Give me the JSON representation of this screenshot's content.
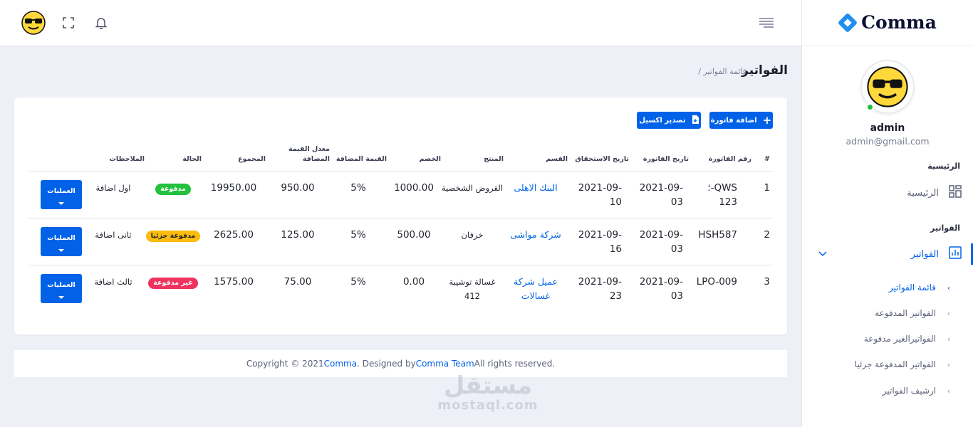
{
  "brand": {
    "name": "Comma"
  },
  "header": {
    "avatar_icon": "sunglasses-emoji",
    "fullscreen_icon": "fullscreen-icon",
    "bell_icon": "bell-icon",
    "menu_icon": "hamburger-icon"
  },
  "profile": {
    "name": "admin",
    "email": "admin@gmail.com"
  },
  "sidebar": {
    "section_home": "الرئيسية",
    "home_label": "الرئيسية",
    "section_invoices": "الفواتير",
    "invoices_label": "الفواتير",
    "sub_items": [
      {
        "label": "قائمة الفواتير"
      },
      {
        "label": "الفواتير المدفوعة"
      },
      {
        "label": "الفواتيرالغير مدفوعة"
      },
      {
        "label": "الفواتير المدفوعة جزئيا"
      },
      {
        "label": "ارشيف الفواتير"
      }
    ]
  },
  "page": {
    "title": "الفواتير",
    "breadcrumb": "/ قائمة الفواتير"
  },
  "actions": {
    "add_invoice": "اضافة فاتورة",
    "export_excel": "تصدير اكسيل"
  },
  "table": {
    "columns": [
      "#",
      "رقم الفاتورة",
      "تاريخ الفاتورة",
      "تاريخ الاستحقاق",
      "القسم",
      "المنتج",
      "الخصم",
      "القيمة المضافة",
      "معدل القيمة المضافة",
      "المجموع",
      "الحالة",
      "الملاحظات",
      ""
    ],
    "rows": [
      {
        "num": "1",
        "invoice_no": "QWS-؛ 123",
        "invoice_date": "2021-09-03",
        "due_date": "2021-09-10",
        "section": "البنك الاهلى",
        "product": "القروض الشخصية",
        "discount": "1000.00",
        "vat_rate": "5%",
        "vat_value": "950.00",
        "total": "19950.00",
        "status": "مدفوعة",
        "status_type": "paid",
        "notes": "اول اضافة",
        "ops": "العمليات"
      },
      {
        "num": "2",
        "invoice_no": "HSH587",
        "invoice_date": "2021-09-03",
        "due_date": "2021-09-16",
        "section": "شركة مواشى",
        "product": "خرفان",
        "discount": "500.00",
        "vat_rate": "5%",
        "vat_value": "125.00",
        "total": "2625.00",
        "status": "مدفوعة جزئيا",
        "status_type": "partial",
        "notes": "ثانى اضافة",
        "ops": "العمليات"
      },
      {
        "num": "3",
        "invoice_no": "LPO-009",
        "invoice_date": "2021-09-03",
        "due_date": "2021-09-23",
        "section": "عميل شركة غسالات",
        "product": "غسالة توشيبة 412",
        "discount": "0.00",
        "vat_rate": "5%",
        "vat_value": "75.00",
        "total": "1575.00",
        "status": "غير مدفوعة",
        "status_type": "unpaid",
        "notes": "ثالث اضافة",
        "ops": "العمليات"
      }
    ]
  },
  "footer": {
    "prefix": "Copyright © 2021 ",
    "brand": "Comma",
    "middle": ". Designed by ",
    "team": "Comma Team",
    "suffix": " All rights reserved."
  },
  "watermark": {
    "line1": "مستقل",
    "line2": "mostaql.com"
  },
  "colors": {
    "primary": "#0162e8",
    "success": "#22c03c",
    "warning": "#fbbc0b",
    "danger": "#ee335e"
  }
}
